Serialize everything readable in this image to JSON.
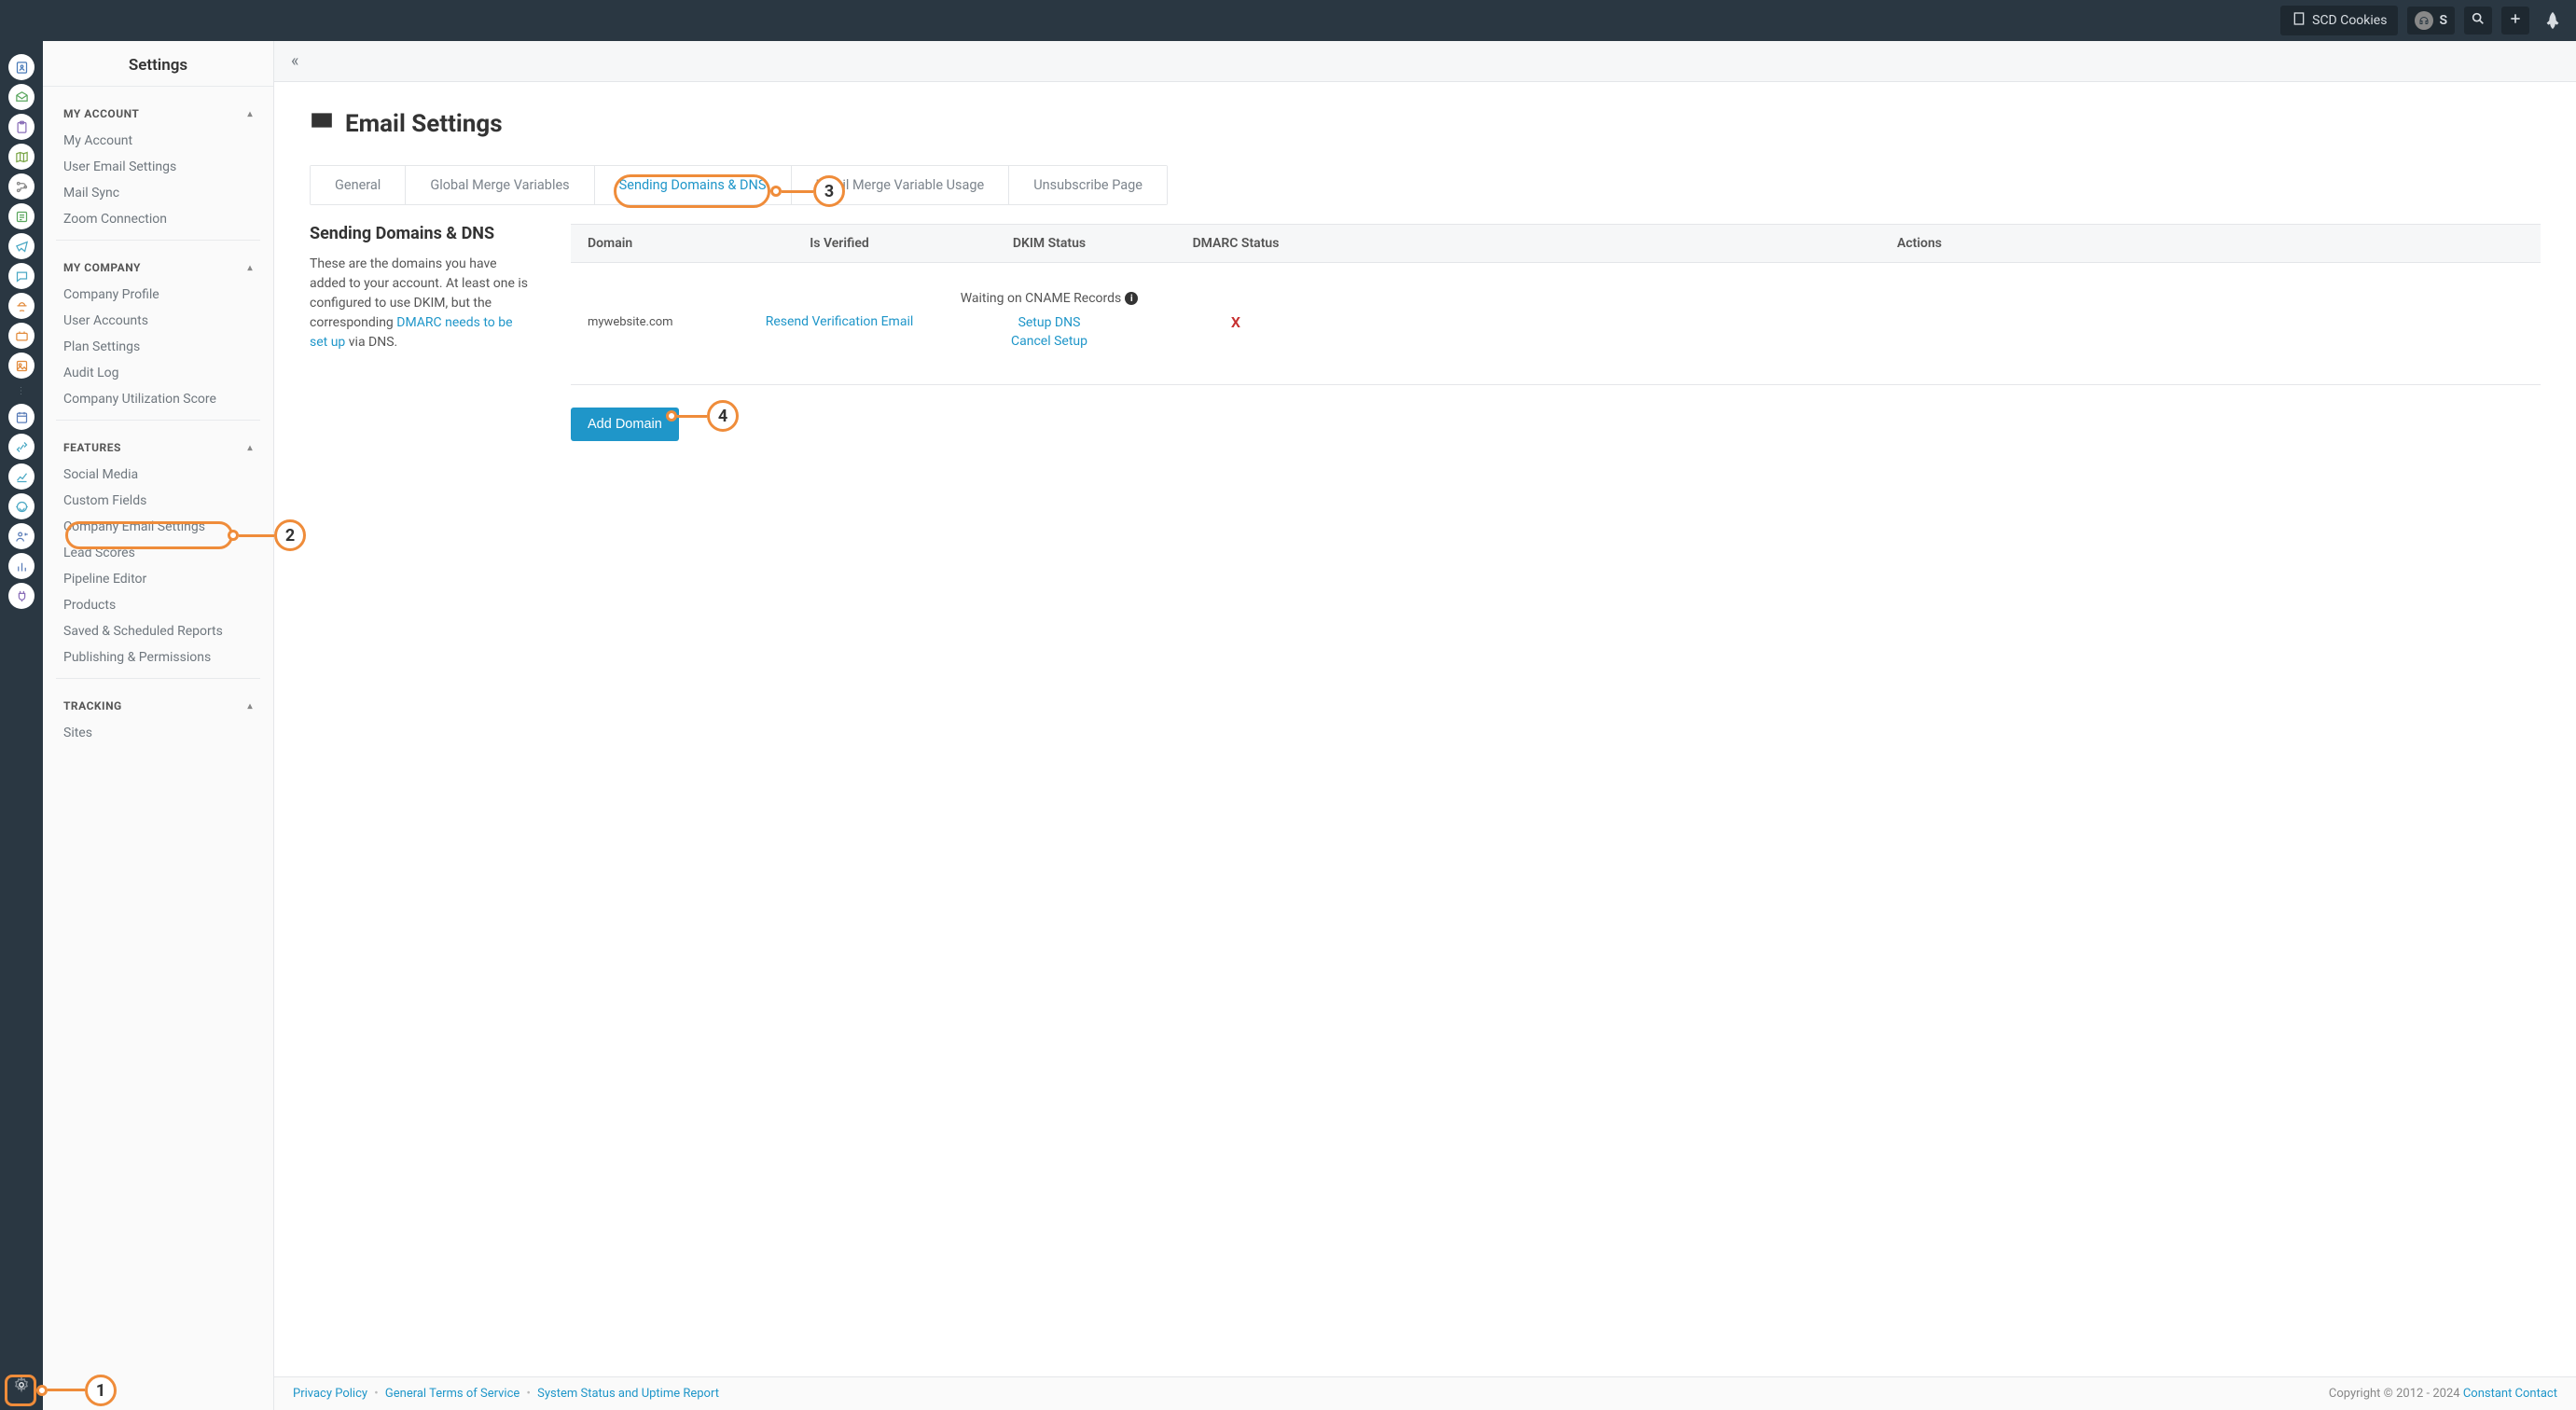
{
  "topbar": {
    "company_button": "SCD Cookies",
    "user_initial": "S"
  },
  "sidebar": {
    "title": "Settings",
    "sections": {
      "my_account": {
        "header": "MY ACCOUNT",
        "items": [
          "My Account",
          "User Email Settings",
          "Mail Sync",
          "Zoom Connection"
        ]
      },
      "my_company": {
        "header": "MY COMPANY",
        "items": [
          "Company Profile",
          "User Accounts",
          "Plan Settings",
          "Audit Log",
          "Company Utilization Score"
        ]
      },
      "features": {
        "header": "FEATURES",
        "items": [
          "Social Media",
          "Custom Fields",
          "Company Email Settings",
          "Lead Scores",
          "Pipeline Editor",
          "Products",
          "Saved & Scheduled Reports",
          "Publishing & Permissions"
        ]
      },
      "tracking": {
        "header": "TRACKING",
        "items": [
          "Sites"
        ]
      }
    }
  },
  "page": {
    "title": "Email Settings",
    "tabs": [
      "General",
      "Global Merge Variables",
      "Sending Domains & DNS",
      "Email Merge Variable Usage",
      "Unsubscribe Page"
    ],
    "active_tab_index": 2,
    "section_title": "Sending Domains & DNS",
    "section_text_a": "These are the domains you have added to your account. At least one is configured to use DKIM, but the corresponding ",
    "section_link": "DMARC needs to be set up",
    "section_text_b": " via DNS.",
    "table": {
      "headers": {
        "domain": "Domain",
        "verified": "Is Verified",
        "dkim": "DKIM Status",
        "dmarc": "DMARC Status",
        "actions": "Actions"
      },
      "row": {
        "domain": "mywebsite.com",
        "verified_link": "Resend Verification Email",
        "dkim_waiting": "Waiting on CNAME Records",
        "dkim_setup": "Setup DNS",
        "dkim_cancel": "Cancel Setup",
        "dmarc": "X"
      }
    },
    "add_domain_button": "Add Domain"
  },
  "footer": {
    "links": [
      "Privacy Policy",
      "General Terms of Service",
      "System Status and Uptime Report"
    ],
    "copyright_prefix": "Copyright © 2012 - 2024 ",
    "copyright_link": "Constant Contact"
  },
  "callouts": {
    "c1": "1",
    "c2": "2",
    "c3": "3",
    "c4": "4"
  }
}
